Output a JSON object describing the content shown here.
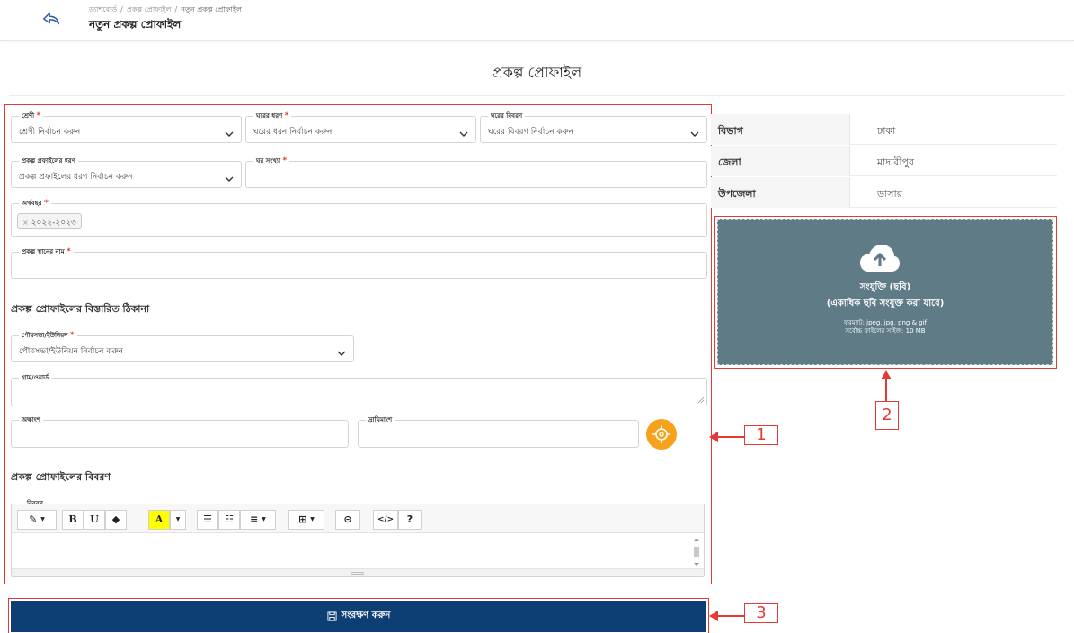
{
  "header": {
    "breadcrumb": [
      "ড্যাশবোর্ড",
      "প্রকল্প প্রোফাইল",
      "নতুন প্রকল্প প্রোফাইল"
    ],
    "breadcrumb_sep": "/",
    "title": "নতুন প্রকল্প প্রোফাইল"
  },
  "page_title": "প্রকল্প প্রোফাইল",
  "form": {
    "category": {
      "label": "শ্রেণী",
      "value": "শ্রেণী নির্বাচন করুন"
    },
    "house_type": {
      "label": "ঘরের ধরণ",
      "value": "ঘরের ধরন নির্বাচন করুন"
    },
    "house_detail": {
      "label": "ঘরের বিবরণ",
      "value": "ঘরের বিবরণ নির্বাচন করুন"
    },
    "profile_type": {
      "label": "প্রকল্প প্রফাইলের ধরণ",
      "value": "প্রকল্প প্রফাইলের ধরণ নির্বাচন করুন"
    },
    "house_count": {
      "label": "ঘর সংখ্যা",
      "value": ""
    },
    "fiscal_year": {
      "label": "অর্থবছর",
      "tag": "২০২২-২০২৩",
      "tag_remove": "×"
    },
    "place_name": {
      "label": "প্রকল্প স্থানের নাম",
      "value": ""
    },
    "address_heading": "প্রকল্প প্রোফাইলের বিস্তারিত ঠিকানা",
    "union": {
      "label": "পৌরসভা/ইউনিয়ন",
      "value": "পৌরসভা/ইউনিয়ন নির্বাচন করুন"
    },
    "village": {
      "label": "গ্রাম/ওয়ার্ড",
      "value": ""
    },
    "latitude": {
      "label": "অক্ষাংশ",
      "value": ""
    },
    "longitude": {
      "label": "দ্রাঘিমাংশ",
      "value": ""
    },
    "description_heading": "প্রকল্প প্রোফাইলের বিবরণ",
    "description": {
      "label": "বিবরণ",
      "value": ""
    },
    "required_mark": "*"
  },
  "editor_toolbar": {
    "bold": "B",
    "underline": "U",
    "font_color": "A",
    "help": "?",
    "code": "</>"
  },
  "save_button": {
    "label": "সংরক্ষণ করুন",
    "icon": "save-icon"
  },
  "location_info": [
    {
      "key": "বিভাগ",
      "value": "ঢাকা"
    },
    {
      "key": "জেলা",
      "value": "মাদারীপুর"
    },
    {
      "key": "উপজেলা",
      "value": "ডাসার"
    }
  ],
  "upload": {
    "icon": "cloud-upload-icon",
    "title": "সংযুক্তি (ছবি)",
    "subtitle": "(একাধিক ছবি সংযুক্ত করা যাবে)",
    "format": "ফরম্যাট: jpeg, jpg, png & gif",
    "max_size": "সর্বোচ্চ ফাইলের সাইজ: 10 MB"
  },
  "callouts": [
    "1",
    "2",
    "3"
  ],
  "colors": {
    "primary": "#0e3f74",
    "annotation": "#e53935",
    "upload_bg": "#5f7b86",
    "location_btn": "#f7a21c",
    "required": "#e53935"
  }
}
